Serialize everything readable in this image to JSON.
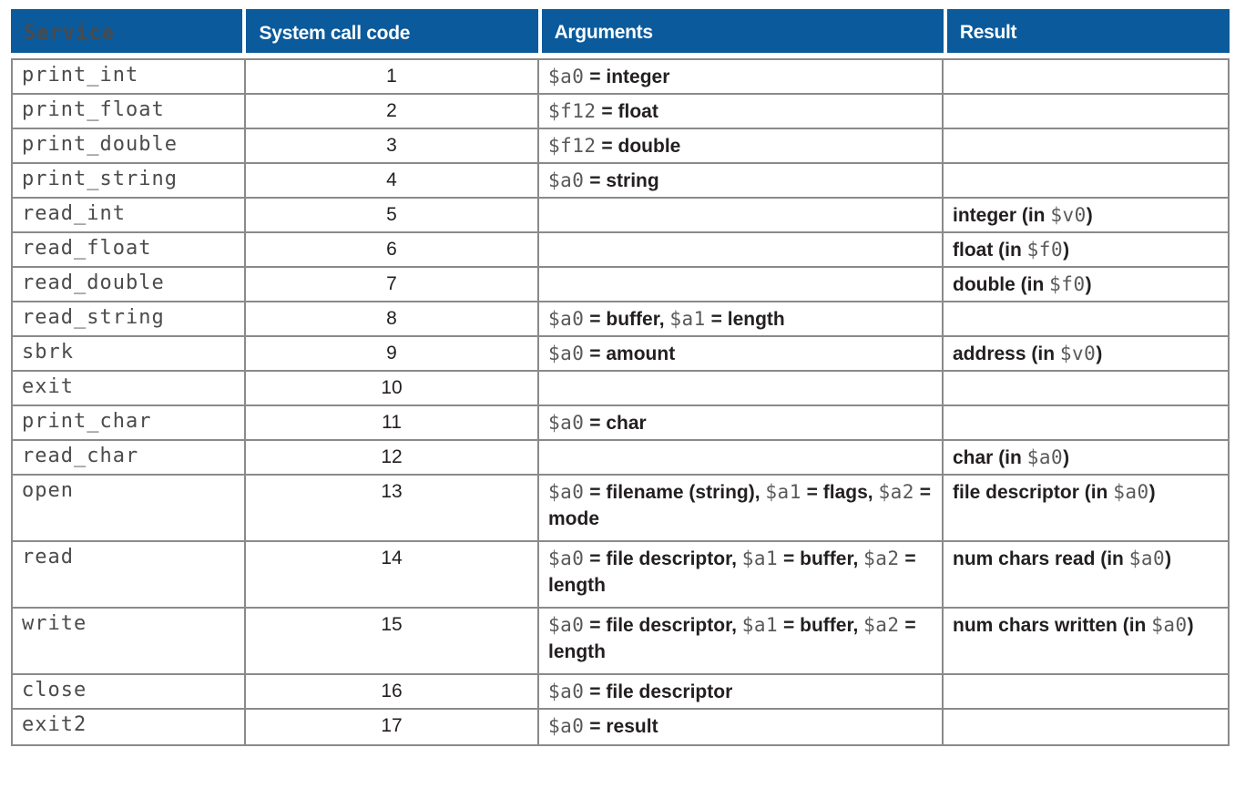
{
  "table": {
    "columns": [
      {
        "key": "service",
        "label": "Service"
      },
      {
        "key": "code",
        "label": "System call code"
      },
      {
        "key": "args",
        "label": "Arguments"
      },
      {
        "key": "result",
        "label": "Result"
      }
    ],
    "header_bg": "#0a5a9c",
    "header_fg": "#ffffff",
    "border_color": "#8a8a8a",
    "rows": [
      {
        "service": "print_int",
        "code": "1",
        "args": "$a0 = integer",
        "result": ""
      },
      {
        "service": "print_float",
        "code": "2",
        "args": "$f12 = float",
        "result": ""
      },
      {
        "service": "print_double",
        "code": "3",
        "args": "$f12 = double",
        "result": ""
      },
      {
        "service": "print_string",
        "code": "4",
        "args": "$a0 = string",
        "result": ""
      },
      {
        "service": "read_int",
        "code": "5",
        "args": "",
        "result": "integer (in $v0)"
      },
      {
        "service": "read_float",
        "code": "6",
        "args": "",
        "result": "float (in $f0)"
      },
      {
        "service": "read_double",
        "code": "7",
        "args": "",
        "result": "double (in $f0)"
      },
      {
        "service": "read_string",
        "code": "8",
        "args": "$a0 = buffer, $a1 = length",
        "result": ""
      },
      {
        "service": "sbrk",
        "code": "9",
        "args": "$a0 = amount",
        "result": "address (in $v0)"
      },
      {
        "service": "exit",
        "code": "10",
        "args": "",
        "result": ""
      },
      {
        "service": "print_char",
        "code": "11",
        "args": "$a0 = char",
        "result": ""
      },
      {
        "service": "read_char",
        "code": "12",
        "args": "",
        "result": "char (in $a0)"
      },
      {
        "service": "open",
        "code": "13",
        "args": "$a0 = filename (string), $a1 = flags, $a2 = mode",
        "result": "file descriptor (in $a0)",
        "tall": true
      },
      {
        "service": "read",
        "code": "14",
        "args": "$a0 = file descriptor, $a1 = buffer, $a2 = length",
        "result": "num chars read (in $a0)",
        "tall": true
      },
      {
        "service": "write",
        "code": "15",
        "args": "$a0 = file descriptor, $a1 = buffer, $a2 = length",
        "result": "num chars written (in $a0)",
        "tall": true
      },
      {
        "service": "close",
        "code": "16",
        "args": "$a0 = file descriptor",
        "result": ""
      },
      {
        "service": "exit2",
        "code": "17",
        "args": "$a0 = result",
        "result": ""
      }
    ]
  }
}
